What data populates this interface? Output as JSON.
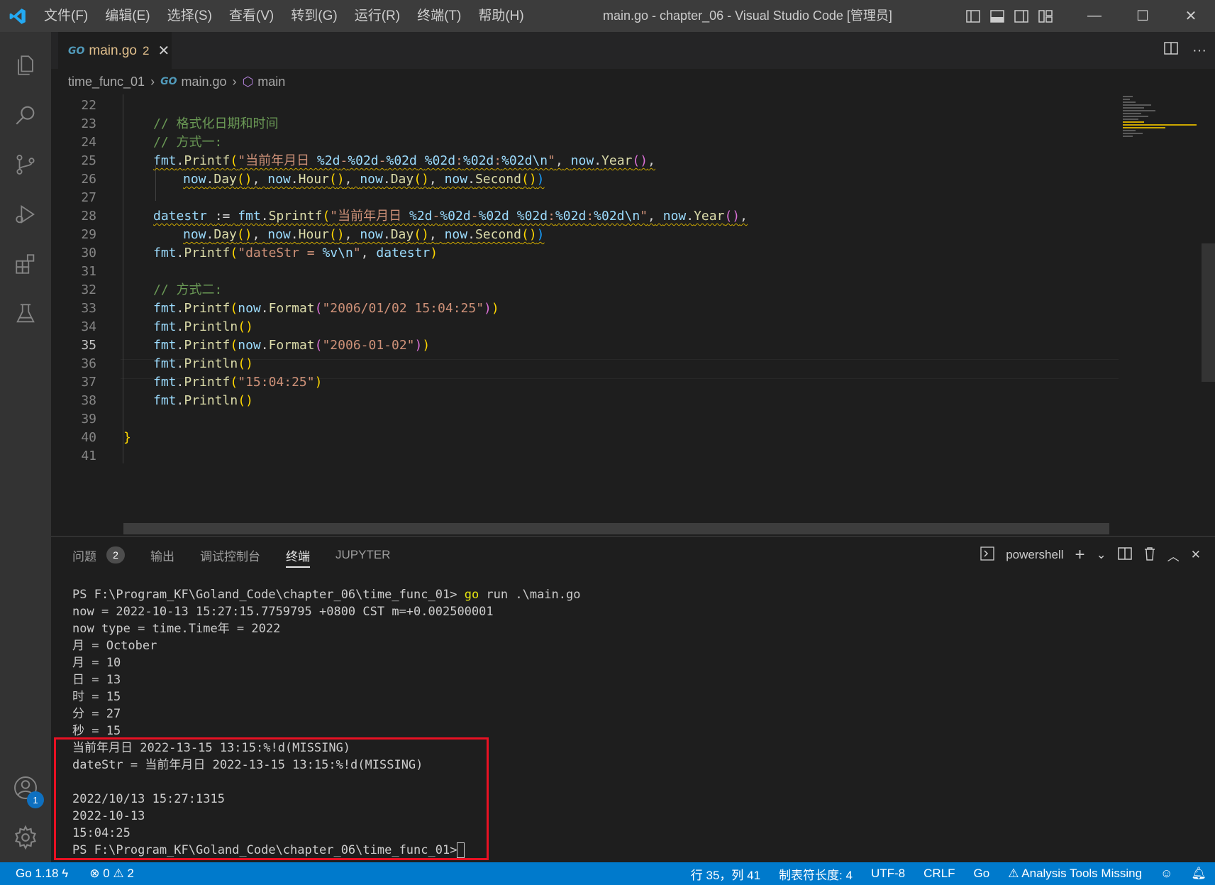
{
  "window": {
    "title": "main.go - chapter_06 - Visual Studio Code [管理员]",
    "menu": [
      "文件(F)",
      "编辑(E)",
      "选择(S)",
      "查看(V)",
      "转到(G)",
      "运行(R)",
      "终端(T)",
      "帮助(H)"
    ]
  },
  "activity_bar": {
    "items": [
      "explorer-icon",
      "search-icon",
      "source-control-icon",
      "run-debug-icon",
      "extensions-icon",
      "testing-icon"
    ],
    "account_badge": "1"
  },
  "tab": {
    "label": "main.go",
    "problem_count": "2",
    "close": "✕"
  },
  "breadcrumb": {
    "folder": "time_func_01",
    "file": "main.go",
    "symbol": "main"
  },
  "editor": {
    "current_line": "35",
    "lines": [
      {
        "n": "22",
        "code": ""
      },
      {
        "n": "23",
        "code": "// 格式化日期和时间"
      },
      {
        "n": "24",
        "code": "// 方式一:"
      },
      {
        "n": "25",
        "code": "fmt.Printf(\"当前年月日 %2d-%02d-%02d %02d:%02d:%02d\\n\", now.Year(),"
      },
      {
        "n": "26",
        "code": "now.Day(), now.Hour(), now.Day(), now.Second())"
      },
      {
        "n": "27",
        "code": ""
      },
      {
        "n": "28",
        "code": "datestr := fmt.Sprintf(\"当前年月日 %2d-%02d-%02d %02d:%02d:%02d\\n\", now.Year(),"
      },
      {
        "n": "29",
        "code": "now.Day(), now.Hour(), now.Day(), now.Second())"
      },
      {
        "n": "30",
        "code": "fmt.Printf(\"dateStr = %v\\n\", datestr)"
      },
      {
        "n": "31",
        "code": ""
      },
      {
        "n": "32",
        "code": "// 方式二:"
      },
      {
        "n": "33",
        "code": "fmt.Printf(now.Format(\"2006/01/02 15:04:25\"))"
      },
      {
        "n": "34",
        "code": "fmt.Println()"
      },
      {
        "n": "35",
        "code": "fmt.Printf(now.Format(\"2006-01-02\"))"
      },
      {
        "n": "36",
        "code": "fmt.Println()"
      },
      {
        "n": "37",
        "code": "fmt.Printf(\"15:04:25\")"
      },
      {
        "n": "38",
        "code": "fmt.Println()"
      },
      {
        "n": "39",
        "code": ""
      },
      {
        "n": "40",
        "code": "}"
      },
      {
        "n": "41",
        "code": ""
      }
    ]
  },
  "panel": {
    "tabs": [
      "问题",
      "输出",
      "调试控制台",
      "终端",
      "JUPYTER"
    ],
    "problems_count": "2",
    "active_tab": "终端",
    "shell": "powershell",
    "terminal_prompt": "PS F:\\Program_KF\\Goland_Code\\chapter_06\\time_func_01>",
    "terminal_command": "go",
    "terminal_command_args": " run .\\main.go",
    "terminal_lines": [
      "now = 2022-10-13 15:27:15.7759795 +0800 CST m=+0.002500001",
      "now type = time.Time年 = 2022",
      "月 = October",
      "月 = 10",
      "日 = 13",
      "时 = 15",
      "分 = 27",
      "秒 = 15",
      "当前年月日 2022-13-15 13:15:%!d(MISSING)",
      "dateStr = 当前年月日 2022-13-15 13:15:%!d(MISSING)",
      "",
      "2022/10/13 15:27:1315",
      "2022-10-13",
      "15:04:25"
    ],
    "final_prompt": "PS F:\\Program_KF\\Goland_Code\\chapter_06\\time_func_01>"
  },
  "status_bar": {
    "go_version": "Go 1.18",
    "errors": "0",
    "warnings": "2",
    "position": "行 35，列 41",
    "tab_size": "制表符长度: 4",
    "encoding": "UTF-8",
    "eol": "CRLF",
    "language": "Go",
    "analysis": "Analysis Tools Missing"
  },
  "colors": {
    "accent": "#007acc",
    "highlight_box": "#e81123",
    "modified_tab": "#e2c08d"
  }
}
